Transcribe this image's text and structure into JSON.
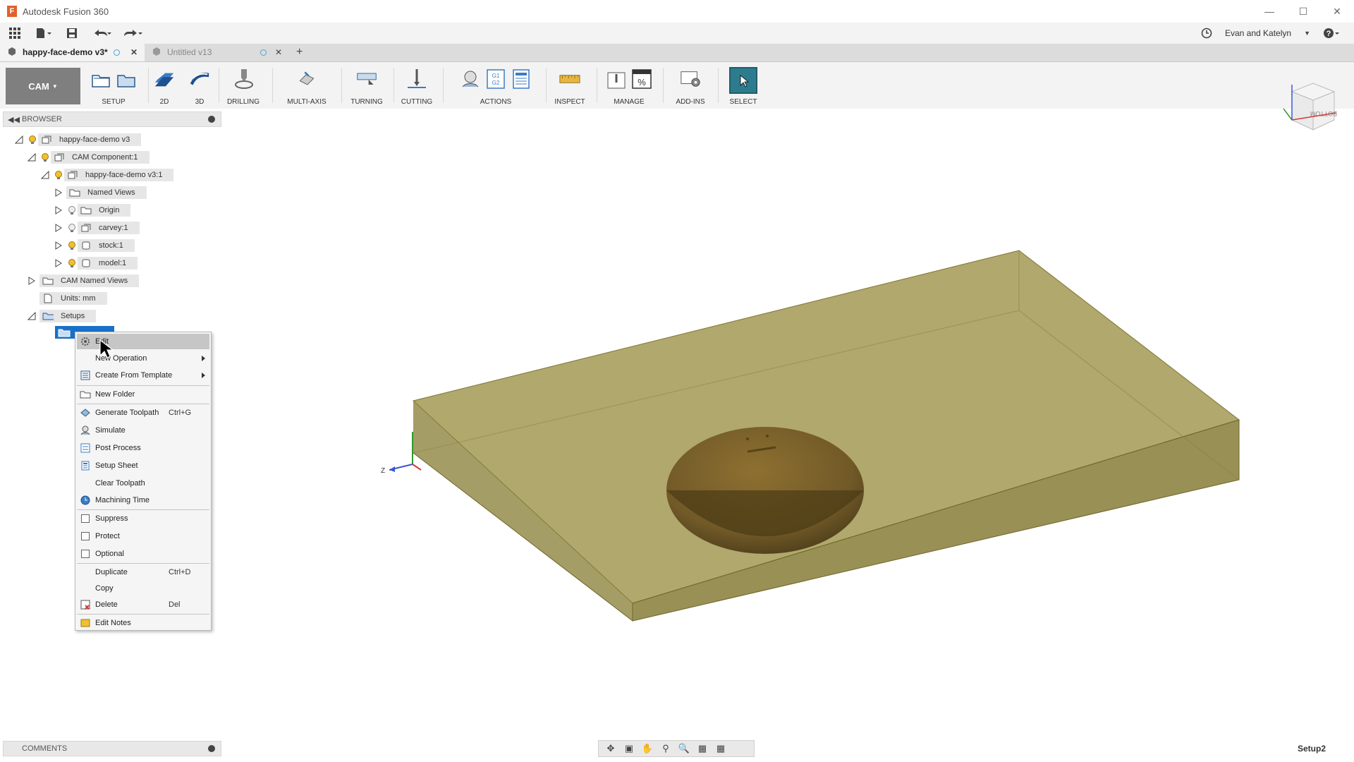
{
  "app": {
    "title": "Autodesk Fusion 360"
  },
  "quick_access": {
    "user": "Evan and Katelyn"
  },
  "tabs": [
    {
      "label": "happy-face-demo v3*"
    },
    {
      "label": "Untitled v13"
    }
  ],
  "ribbon": {
    "workspace": "CAM",
    "groups": [
      "SETUP",
      "2D",
      "3D",
      "DRILLING",
      "MULTI-AXIS",
      "TURNING",
      "CUTTING",
      "ACTIONS",
      "INSPECT",
      "MANAGE",
      "ADD-INS",
      "SELECT"
    ]
  },
  "browser": {
    "title": "BROWSER",
    "items": [
      {
        "label": "happy-face-demo v3"
      },
      {
        "label": "CAM Component:1"
      },
      {
        "label": "happy-face-demo v3:1"
      },
      {
        "label": "Named Views"
      },
      {
        "label": "Origin"
      },
      {
        "label": "carvey:1"
      },
      {
        "label": "stock:1"
      },
      {
        "label": "model:1"
      },
      {
        "label": "CAM Named Views"
      },
      {
        "label": "Units: mm"
      },
      {
        "label": "Setups"
      }
    ]
  },
  "context_menu": {
    "items": [
      {
        "label": "Edit",
        "shortcut": ""
      },
      {
        "label": "New Operation",
        "shortcut": ""
      },
      {
        "label": "Create From Template",
        "shortcut": ""
      },
      {
        "label": "New Folder",
        "shortcut": ""
      },
      {
        "label": "Generate Toolpath",
        "shortcut": "Ctrl+G"
      },
      {
        "label": "Simulate",
        "shortcut": ""
      },
      {
        "label": "Post Process",
        "shortcut": ""
      },
      {
        "label": "Setup Sheet",
        "shortcut": ""
      },
      {
        "label": "Clear Toolpath",
        "shortcut": ""
      },
      {
        "label": "Machining Time",
        "shortcut": ""
      },
      {
        "label": "Suppress",
        "shortcut": ""
      },
      {
        "label": "Protect",
        "shortcut": ""
      },
      {
        "label": "Optional",
        "shortcut": ""
      },
      {
        "label": "Duplicate",
        "shortcut": "Ctrl+D"
      },
      {
        "label": "Copy",
        "shortcut": ""
      },
      {
        "label": "Delete",
        "shortcut": "Del"
      },
      {
        "label": "Edit Notes",
        "shortcut": ""
      }
    ]
  },
  "viewcube": {
    "face_label": "BOTTOM"
  },
  "triad": {
    "z_label": "Z"
  },
  "comments": {
    "title": "COMMENTS"
  },
  "status": {
    "active_setup": "Setup2"
  },
  "colors": {
    "stock_fill": "#8a8034",
    "hemisphere": "#6b5522",
    "selection": "#1a70c8",
    "select_btn": "#2d7c8e"
  }
}
